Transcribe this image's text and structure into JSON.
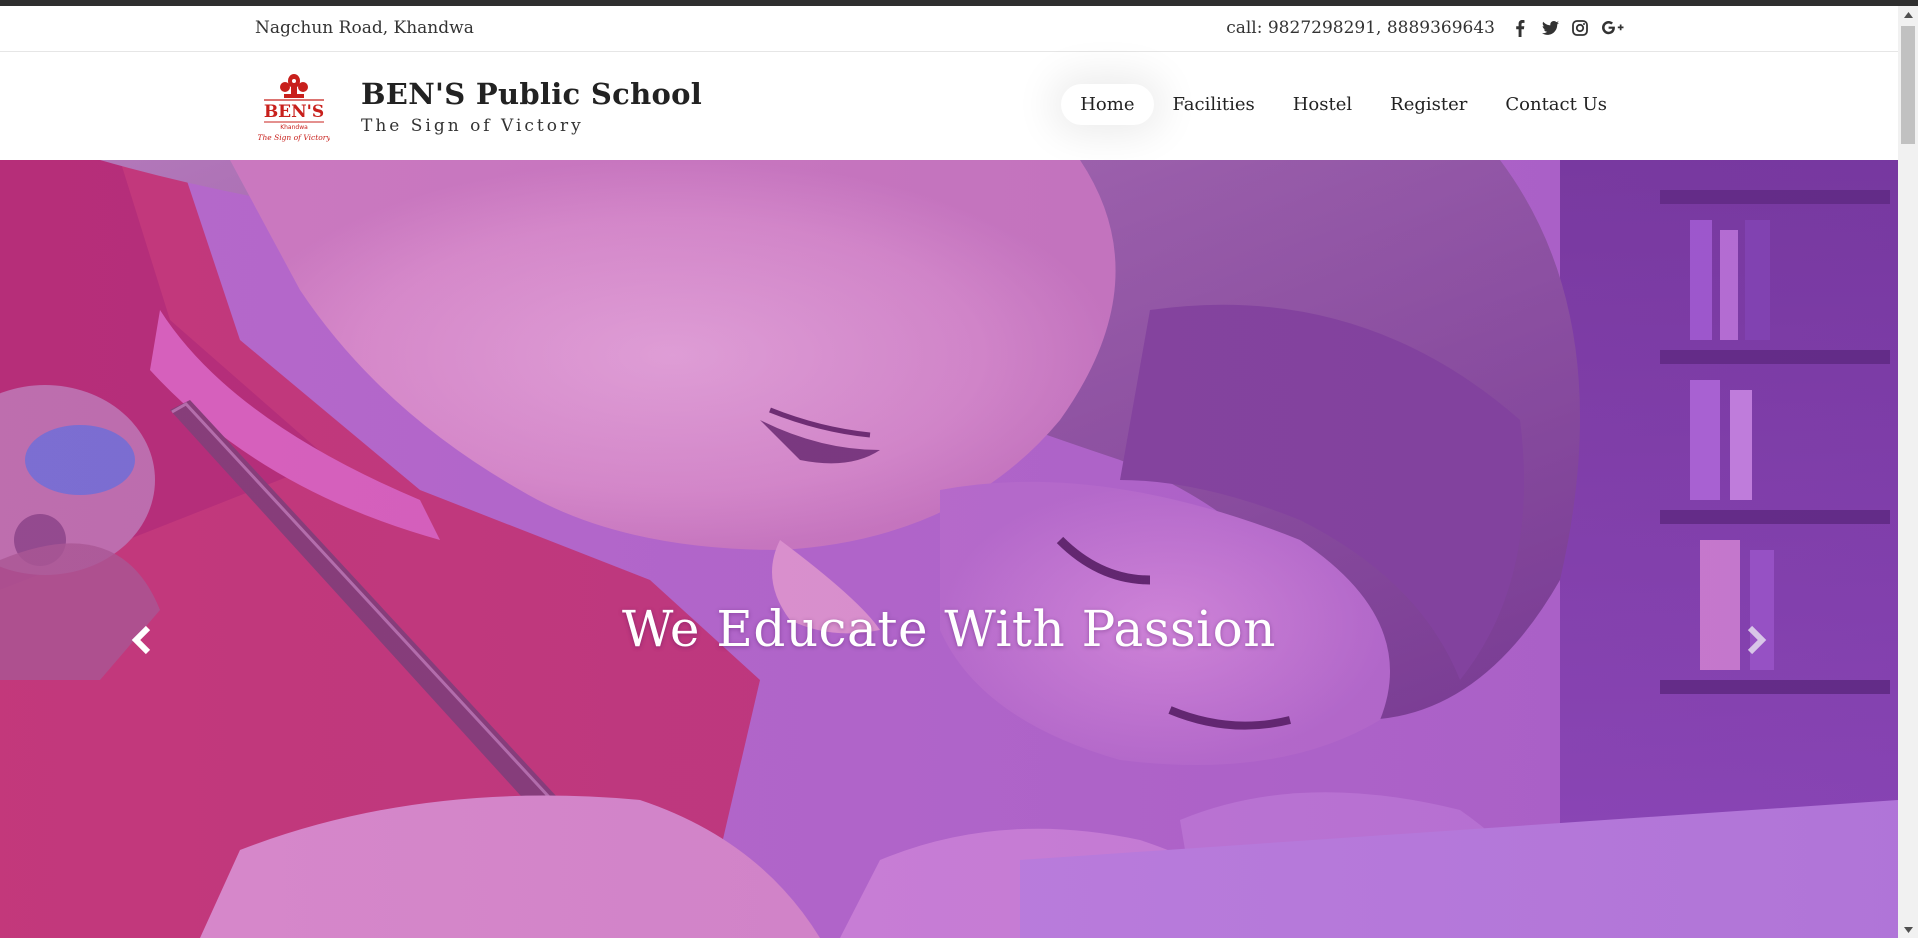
{
  "topbar": {
    "address": "Nagchun Road, Khandwa",
    "phone": "call: 9827298291, 8889369643",
    "social": [
      {
        "name": "facebook-icon",
        "glyph": "f"
      },
      {
        "name": "twitter-icon",
        "glyph": "t"
      },
      {
        "name": "instagram-icon",
        "glyph": "o"
      },
      {
        "name": "google-plus-icon",
        "glyph": "G+"
      }
    ]
  },
  "header": {
    "logo": {
      "text_main": "BEN'S",
      "text_city": "Khandwa",
      "text_tagline": "The Sign of Victory"
    },
    "title": "BEN'S Public School",
    "subtitle": "The Sign of Victory",
    "nav": [
      {
        "label": "Home",
        "active": true
      },
      {
        "label": "Facilities",
        "active": false
      },
      {
        "label": "Hostel",
        "active": false
      },
      {
        "label": "Register",
        "active": false
      },
      {
        "label": "Contact Us",
        "active": false
      }
    ]
  },
  "hero": {
    "heading": "We Educate With Passion",
    "overlay_color": "#b23fd6",
    "prev_icon": "chevron-left-icon",
    "next_icon": "chevron-right-icon"
  },
  "colors": {
    "logo_red": "#c8201c",
    "text_dark": "#222222"
  }
}
